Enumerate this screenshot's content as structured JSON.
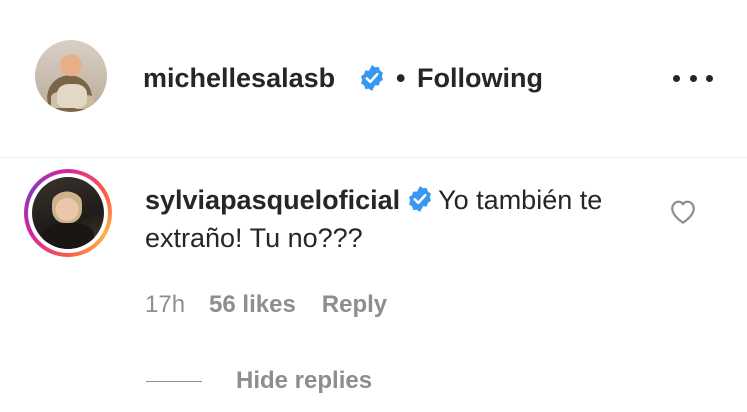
{
  "post_header": {
    "username": "michellesalasb",
    "verified_icon": "verified-badge-icon",
    "separator": "•",
    "follow_status": "Following",
    "more_icon": "more-options-icon"
  },
  "comment": {
    "username": "sylviapasqueloficial",
    "verified_icon": "verified-badge-icon",
    "text": "Yo también te extraño! Tu no???",
    "time": "17h",
    "likes": "56 likes",
    "reply_label": "Reply",
    "like_icon": "heart-icon",
    "hide_replies_label": "Hide replies"
  },
  "colors": {
    "text": "#262626",
    "secondary": "#8e8e8e",
    "verified": "#3897f0"
  }
}
